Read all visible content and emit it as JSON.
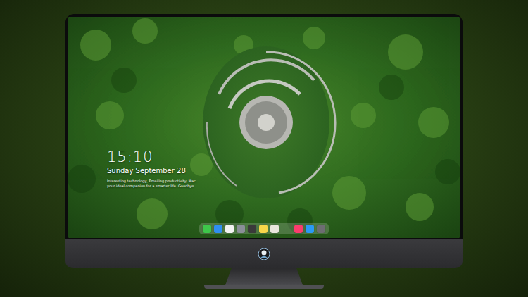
{
  "lock_screen": {
    "time": "15:10",
    "date": "Sunday September 28",
    "caption": [
      "Interesting technology, Emailing productivity, Mac.",
      "your ideal companion for a smarter life. Goodbye"
    ]
  },
  "dock": {
    "items": [
      {
        "color": "#3ec74a"
      },
      {
        "color": "#2f8ff0"
      },
      {
        "color": "#f2f2f2"
      },
      {
        "color": "#8a8f98"
      },
      {
        "color": "#3a3a3a"
      },
      {
        "color": "#f7d64a"
      },
      {
        "color": "#e9e6dc"
      },
      {
        "color": "#fa3d6d"
      },
      {
        "color": "#2a9af5"
      },
      {
        "color": "#6d6d72"
      }
    ]
  }
}
